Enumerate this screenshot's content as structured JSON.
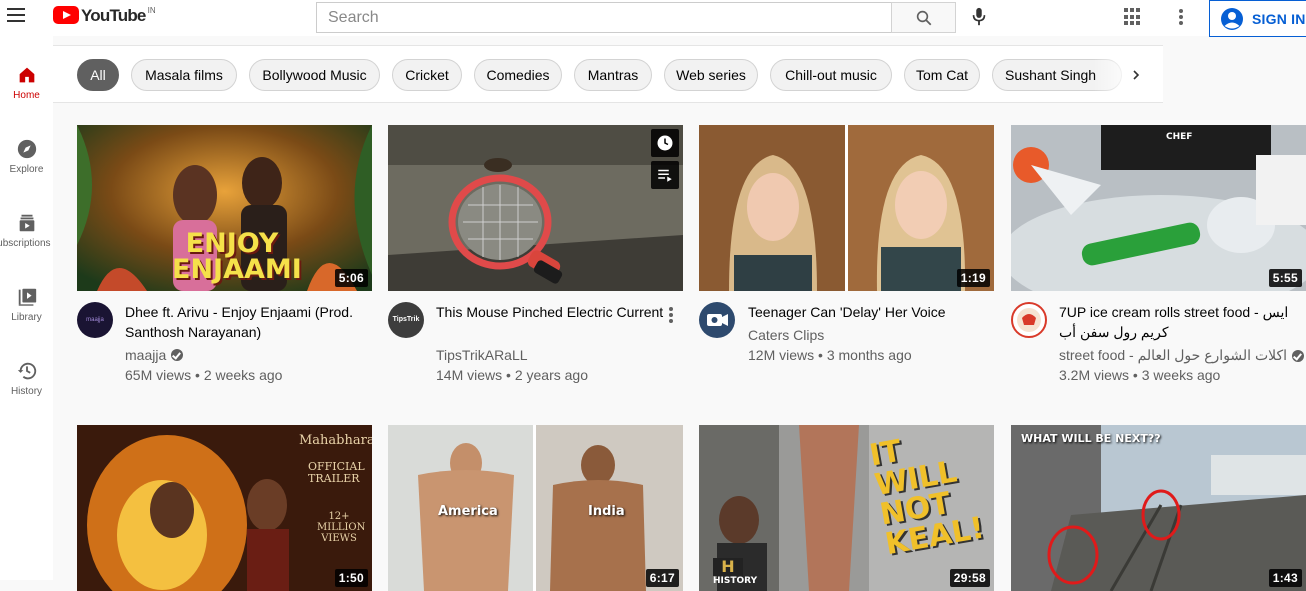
{
  "header": {
    "logo_text": "YouTube",
    "country_code": "IN",
    "search_placeholder": "Search",
    "signin_label": "SIGN IN",
    "icons": [
      "menu-icon",
      "search-icon",
      "mic-icon",
      "apps-icon",
      "more-vert-icon",
      "account-icon"
    ]
  },
  "sidebar": {
    "items": [
      {
        "label": "Home",
        "icon": "home-icon",
        "active": true
      },
      {
        "label": "Explore",
        "icon": "compass-icon",
        "active": false
      },
      {
        "label": "Subscriptions",
        "icon": "subscriptions-icon",
        "active": false
      },
      {
        "label": "Library",
        "icon": "library-icon",
        "active": false
      },
      {
        "label": "History",
        "icon": "history-icon",
        "active": false
      }
    ]
  },
  "chips": [
    "All",
    "Masala films",
    "Bollywood Music",
    "Cricket",
    "Comedies",
    "Mantras",
    "Web series",
    "Chill-out music",
    "Tom Cat",
    "Sushant Singh"
  ],
  "videos": [
    {
      "title": "Dhee ft. Arivu - Enjoy Enjaami (Prod. Santhosh Narayanan)",
      "channel": "maajja",
      "verified": true,
      "views": "65M views",
      "age": "2 weeks ago",
      "duration": "5:06",
      "thumb_text": "ENJOY ENJAAMI",
      "avatar_text": "maajja"
    },
    {
      "title": "This Mouse Pinched Electric Current",
      "channel": "TipsTrikARaLL",
      "verified": false,
      "views": "14M views",
      "age": "2 years ago",
      "duration": "",
      "avatar_text": "TipsTrik"
    },
    {
      "title": "Teenager Can 'Delay' Her Voice",
      "channel": "Caters Clips",
      "verified": false,
      "views": "12M views",
      "age": "3 months ago",
      "duration": "1:19"
    },
    {
      "title": "7UP ice cream rolls street food - ايس كريم رول سفن أب",
      "channel": "street food - اكلات الشوارع حول العالم",
      "verified": true,
      "views": "3.2M views",
      "age": "3 weeks ago",
      "duration": "5:55",
      "thumb_text": "CHEF"
    },
    {
      "title": "",
      "duration": "1:50",
      "thumb_text": [
        "Mahabharat",
        "OFFICIAL TRAILER",
        "12+ MILLION VIEWS"
      ]
    },
    {
      "title": "",
      "duration": "6:17",
      "thumb_text": [
        "America",
        "India"
      ]
    },
    {
      "title": "",
      "duration": "29:58",
      "thumb_text": [
        "IT WILL",
        "NOT",
        "KEAL!",
        "HISTORY"
      ]
    },
    {
      "title": "",
      "duration": "1:43",
      "thumb_text": "WHAT WILL BE NEXT??"
    }
  ]
}
